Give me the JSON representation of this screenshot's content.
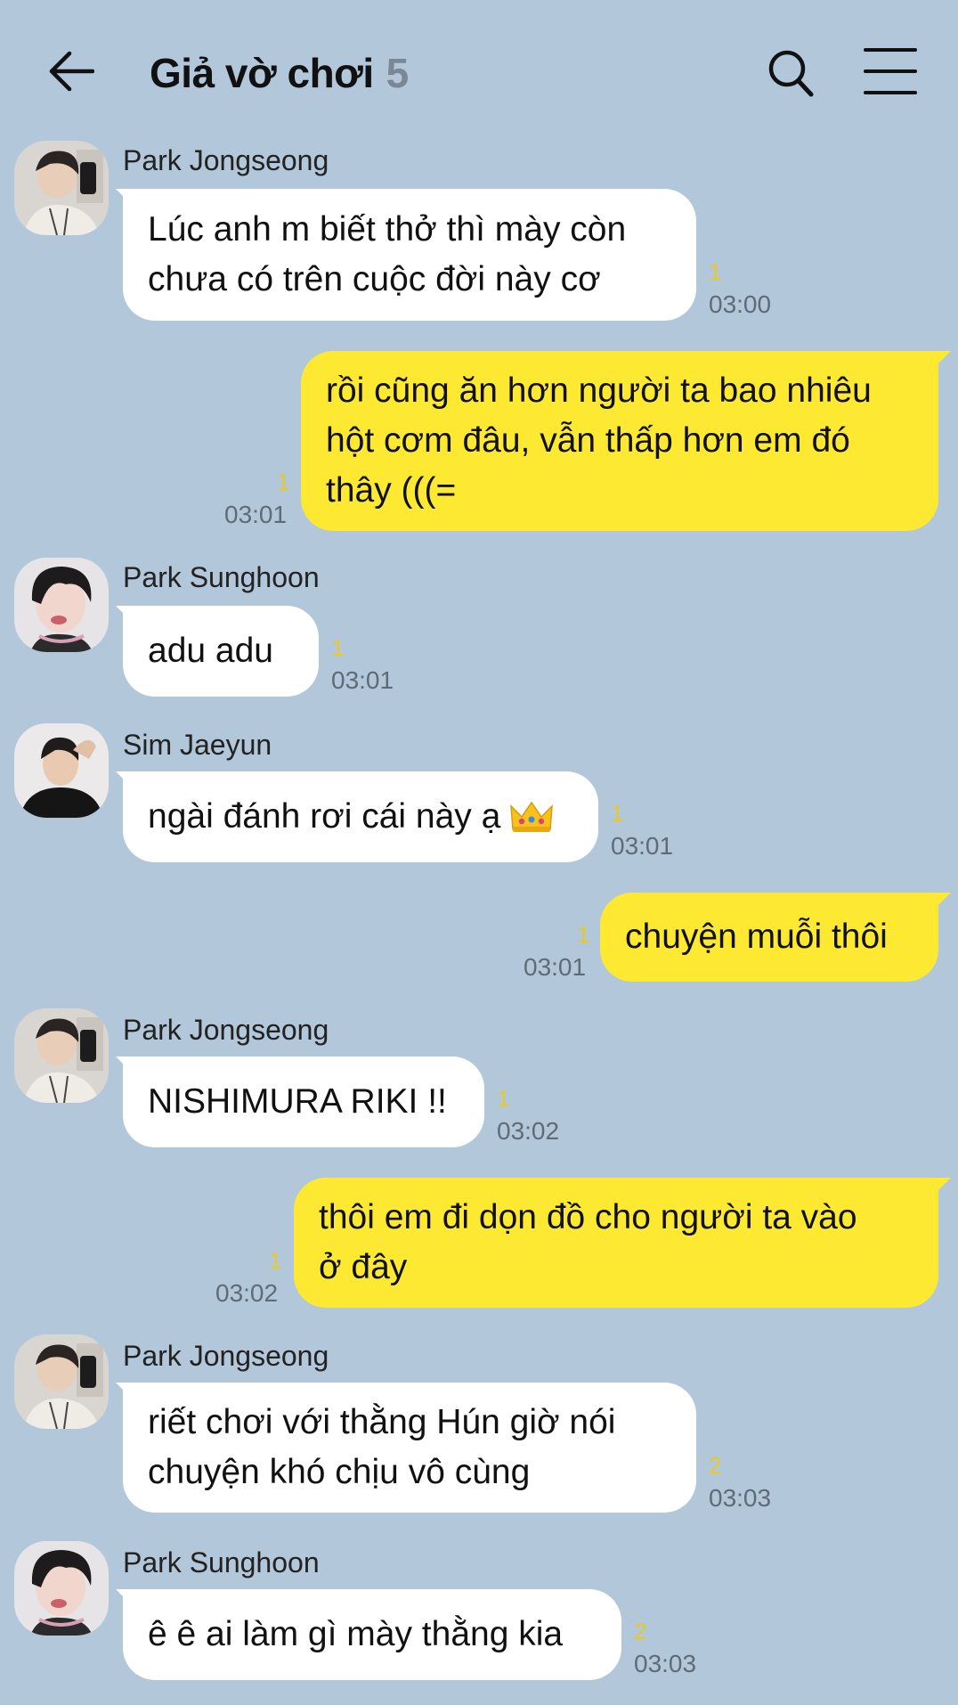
{
  "header": {
    "title": "Giả vờ chơi",
    "member_count": "5",
    "icons": [
      "back-arrow-icon",
      "search-icon",
      "menu-icon"
    ]
  },
  "colors": {
    "background": "#b2c7da",
    "incoming_bubble": "#ffffff",
    "outgoing_bubble": "#fde931",
    "unread_count": "#e8c926"
  },
  "messages": [
    {
      "direction": "in",
      "sender": "Park Jongseong",
      "text": "Lúc anh m biết thở thì mày còn\nchưa có trên cuộc đời này cơ",
      "unread": "1",
      "time": "03:00"
    },
    {
      "direction": "out",
      "text": "rồi cũng ăn hơn người ta bao nhiêu\nhột cơm đâu, vẫn thấp hơn em đó\nthây (((=",
      "unread": "1",
      "time": "03:01"
    },
    {
      "direction": "in",
      "sender": "Park Sunghoon",
      "text": "adu adu",
      "unread": "1",
      "time": "03:01"
    },
    {
      "direction": "in",
      "sender": "Sim Jaeyun",
      "text": "ngài đánh rơi cái này ạ",
      "emoji": "crown-icon",
      "unread": "1",
      "time": "03:01"
    },
    {
      "direction": "out",
      "text": "chuyện muỗi thôi",
      "unread": "1",
      "time": "03:01"
    },
    {
      "direction": "in",
      "sender": "Park Jongseong",
      "text": "NISHIMURA RIKI !!",
      "unread": "1",
      "time": "03:02"
    },
    {
      "direction": "out",
      "text": "thôi em đi dọn đồ cho người ta vào\nở đây",
      "unread": "1",
      "time": "03:02"
    },
    {
      "direction": "in",
      "sender": "Park Jongseong",
      "text": "riết chơi với thằng Hún giờ nói\nchuyện khó chịu vô cùng",
      "unread": "2",
      "time": "03:03"
    },
    {
      "direction": "in",
      "sender": "Park Sunghoon",
      "text": "ê ê ai làm gì mày thằng kia",
      "unread": "2",
      "time": "03:03"
    }
  ]
}
